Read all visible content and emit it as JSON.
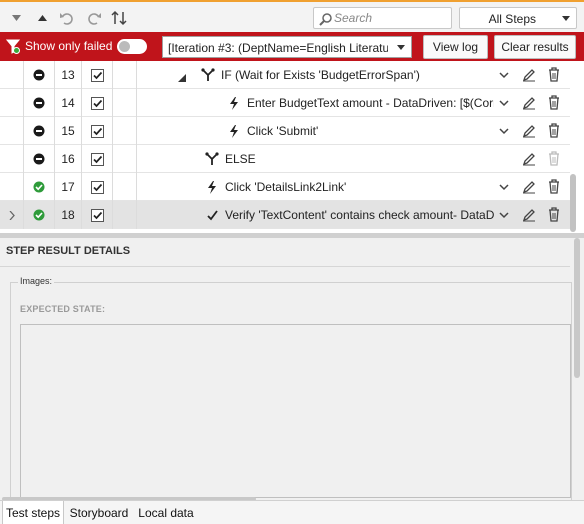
{
  "toolbar": {
    "search_placeholder": "Search",
    "steps_filter": "All Steps"
  },
  "filter_bar": {
    "show_only_failed_label": "Show only failed",
    "show_only_failed_on": false,
    "iteration_value": "[Iteration #3: (DeptName=English Literatu",
    "view_log_label": "View log",
    "clear_results_label": "Clear results",
    "bar_color": "#c0141b"
  },
  "steps": [
    {
      "num": "13",
      "status": "not-run",
      "checked": true,
      "icon": "if-branch-icon",
      "expand": "collapse-triangle",
      "text": "IF (Wait for Exists 'BudgetErrorSpan')",
      "has_chevron": true,
      "delete_enabled": true
    },
    {
      "num": "14",
      "status": "not-run",
      "checked": true,
      "icon": "lightning-icon",
      "expand": "",
      "text": "Enter BudgetText amount - DataDriven: [$(Corr",
      "has_chevron": true,
      "delete_enabled": true
    },
    {
      "num": "15",
      "status": "not-run",
      "checked": true,
      "icon": "lightning-icon",
      "expand": "",
      "text": "Click 'Submit'",
      "has_chevron": true,
      "delete_enabled": true
    },
    {
      "num": "16",
      "status": "not-run",
      "checked": true,
      "icon": "if-branch-icon",
      "expand": "",
      "text": "ELSE",
      "has_chevron": false,
      "delete_enabled": false
    },
    {
      "num": "17",
      "status": "passed",
      "checked": true,
      "icon": "lightning-icon",
      "expand": "",
      "text": "Click 'DetailsLink2Link'",
      "has_chevron": true,
      "delete_enabled": true
    },
    {
      "num": "18",
      "status": "passed",
      "checked": true,
      "icon": "verify-check-icon",
      "expand": "",
      "text": "Verify 'TextContent' contains check amount- DataD",
      "has_chevron": true,
      "delete_enabled": true,
      "selected": true
    }
  ],
  "details": {
    "title": "STEP RESULT DETAILS",
    "images_label": "Images:",
    "expected_state_label": "EXPECTED STATE:"
  },
  "tabs": [
    {
      "label": "Test steps",
      "active": true
    },
    {
      "label": "Storyboard",
      "active": false
    },
    {
      "label": "Local data",
      "active": false
    }
  ],
  "colors": {
    "passed": "#2e9b3a",
    "not_run": "#1a1a1a",
    "accent": "#f0a030"
  }
}
